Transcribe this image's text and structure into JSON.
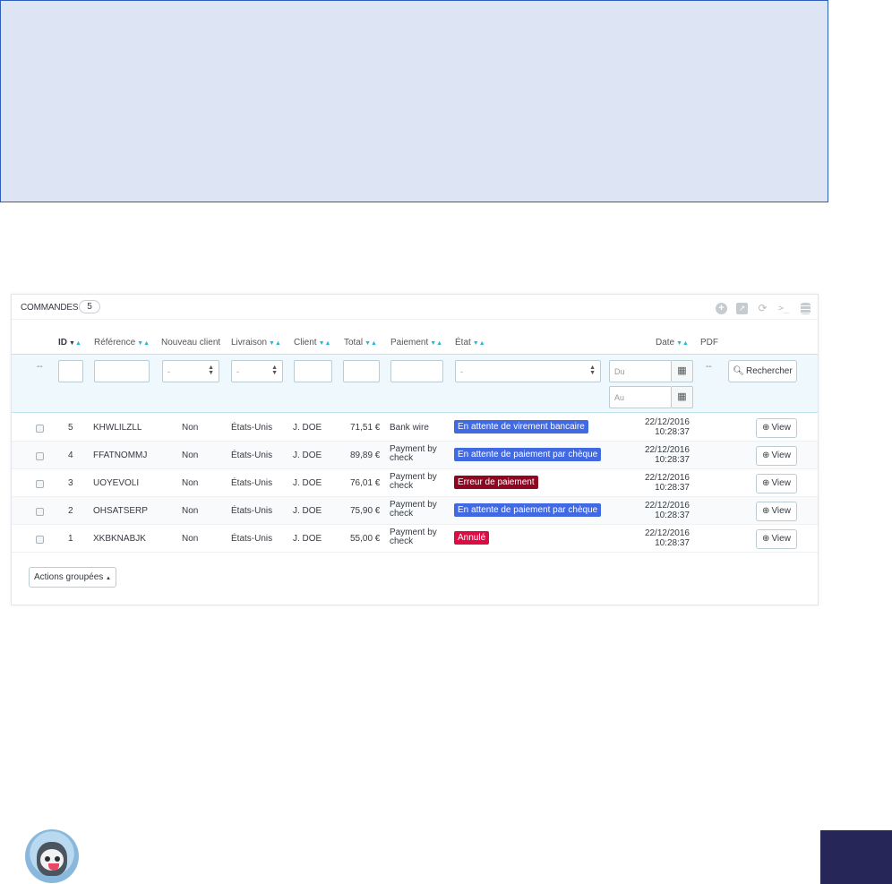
{
  "panel": {
    "title": "COMMANDES",
    "count": "5",
    "toolbar": [
      "add-icon",
      "export-icon",
      "refresh-icon",
      "sql-icon",
      "database-icon"
    ]
  },
  "columns": {
    "id": "ID",
    "reference": "Référence",
    "new_client": "Nouveau client",
    "delivery": "Livraison",
    "client": "Client",
    "total": "Total",
    "payment": "Paiement",
    "state": "État",
    "date": "Date",
    "pdf": "PDF"
  },
  "filters": {
    "empty": "--",
    "select_placeholder": "-",
    "date_from": "Du",
    "date_to": "Au",
    "search_label": "Rechercher"
  },
  "rows": [
    {
      "id": "5",
      "reference": "KHWLILZLL",
      "new_client": "Non",
      "delivery": "États-Unis",
      "client": "J. DOE",
      "total": "71,51 €",
      "payment": "Bank wire",
      "state": "En attente de virement bancaire",
      "state_color": "#4169e1",
      "date": "22/12/2016",
      "time": "10:28:37",
      "view": "View"
    },
    {
      "id": "4",
      "reference": "FFATNOMMJ",
      "new_client": "Non",
      "delivery": "États-Unis",
      "client": "J. DOE",
      "total": "89,89 €",
      "payment": "Payment by check",
      "state": "En attente de paiement par chèque",
      "state_color": "#4169e1",
      "date": "22/12/2016",
      "time": "10:28:37",
      "view": "View"
    },
    {
      "id": "3",
      "reference": "UOYEVOLI",
      "new_client": "Non",
      "delivery": "États-Unis",
      "client": "J. DOE",
      "total": "76,01 €",
      "payment": "Payment by check",
      "state": "Erreur de paiement",
      "state_color": "#8f0621",
      "date": "22/12/2016",
      "time": "10:28:37",
      "view": "View"
    },
    {
      "id": "2",
      "reference": "OHSATSERP",
      "new_client": "Non",
      "delivery": "États-Unis",
      "client": "J. DOE",
      "total": "75,90 €",
      "payment": "Payment by check",
      "state": "En attente de paiement par chèque",
      "state_color": "#4169e1",
      "date": "22/12/2016",
      "time": "10:28:37",
      "view": "View"
    },
    {
      "id": "1",
      "reference": "XKBKNABJK",
      "new_client": "Non",
      "delivery": "États-Unis",
      "client": "J. DOE",
      "total": "55,00 €",
      "payment": "Payment by check",
      "state": "Annulé",
      "state_color": "#dc0c45",
      "date": "22/12/2016",
      "time": "10:28:37",
      "view": "View"
    }
  ],
  "bulk_actions": "Actions groupées",
  "colors": {
    "accent": "#25b9d7",
    "top_box_bg": "#dde5f4",
    "top_box_border": "#2f5fb8",
    "corner_box": "#272658"
  }
}
